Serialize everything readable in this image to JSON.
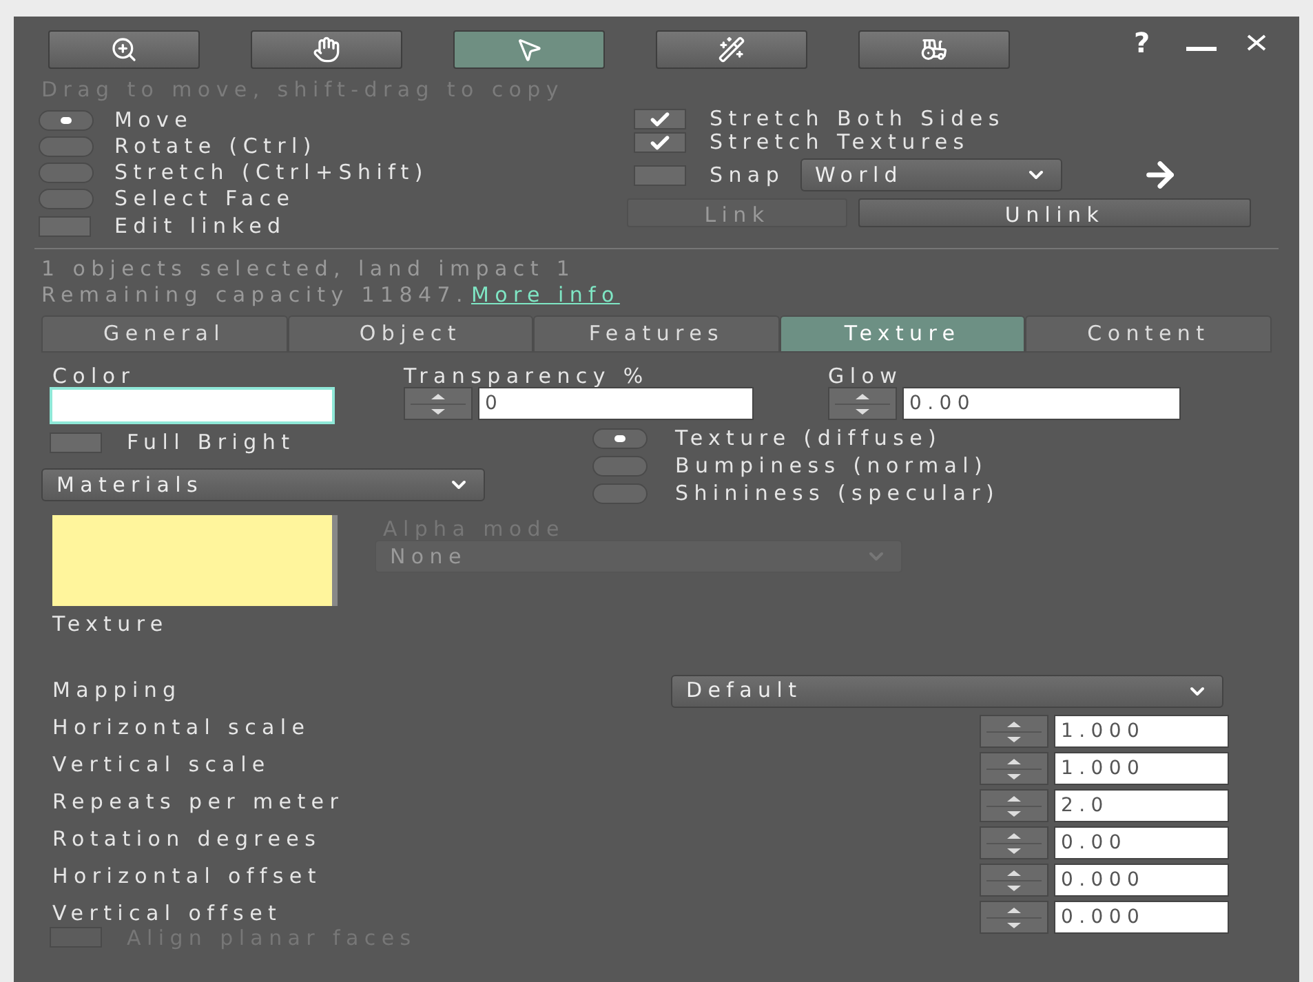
{
  "toolbar": {
    "tools": [
      {
        "kind": "zoom",
        "selected": false
      },
      {
        "kind": "grab",
        "selected": false
      },
      {
        "kind": "edit",
        "selected": true
      },
      {
        "kind": "create",
        "selected": false
      },
      {
        "kind": "land",
        "selected": false
      }
    ],
    "help": "?"
  },
  "hint": "Drag to move, shift-drag to copy",
  "edit_modes": [
    {
      "label": "Move",
      "selected": true
    },
    {
      "label": "Rotate (Ctrl)",
      "selected": false
    },
    {
      "label": "Stretch (Ctrl+Shift)",
      "selected": false
    },
    {
      "label": "Select Face",
      "selected": false
    }
  ],
  "edit_linked": {
    "label": "Edit linked",
    "checked": false
  },
  "options": [
    {
      "label": "Stretch Both Sides",
      "checked": true
    },
    {
      "label": "Stretch Textures",
      "checked": true
    },
    {
      "label": "Snap",
      "checked": false
    }
  ],
  "snap_dropdown": {
    "value": "World"
  },
  "link_buttons": [
    {
      "label": "Link",
      "disabled": true
    },
    {
      "label": "Unlink",
      "disabled": false
    }
  ],
  "info": {
    "line_1": "1 objects selected, land impact 1",
    "line_2": "Remaining capacity 11847.",
    "link": "More info"
  },
  "tabs": [
    {
      "label": "General",
      "selected": false
    },
    {
      "label": "Object",
      "selected": false
    },
    {
      "label": "Features",
      "selected": false
    },
    {
      "label": "Texture",
      "selected": true
    },
    {
      "label": "Content",
      "selected": false
    }
  ],
  "color": {
    "label": "Color",
    "color": "#ffffff"
  },
  "transparency": {
    "label": "Transparency %",
    "value": "0"
  },
  "glow": {
    "label": "Glow",
    "value": "0.00"
  },
  "full_bright": {
    "label": "Full Bright",
    "checked": false
  },
  "materials_dropdown": {
    "value": "Materials"
  },
  "material_channels": [
    {
      "label": "Texture (diffuse)",
      "selected": true
    },
    {
      "label": "Bumpiness (normal)",
      "selected": false
    },
    {
      "label": "Shininess (specular)",
      "selected": false
    }
  ],
  "texture": {
    "label": "Texture",
    "color": "#fff59c"
  },
  "alpha_mode": {
    "label": "Alpha mode",
    "value": "None",
    "disabled": true
  },
  "mapping": {
    "label": "Mapping",
    "value": "Default"
  },
  "params": [
    {
      "label": "Horizontal scale",
      "value": "1.000"
    },
    {
      "label": "Vertical scale",
      "value": "1.000"
    },
    {
      "label": "Repeats per meter",
      "value": "2.0"
    },
    {
      "label": "Rotation degrees",
      "value": "0.00"
    },
    {
      "label": "Horizontal offset",
      "value": "0.000"
    },
    {
      "label": "Vertical offset",
      "value": "0.000"
    }
  ],
  "align_planar": {
    "label": "Align planar faces",
    "checked": false,
    "disabled": true
  }
}
